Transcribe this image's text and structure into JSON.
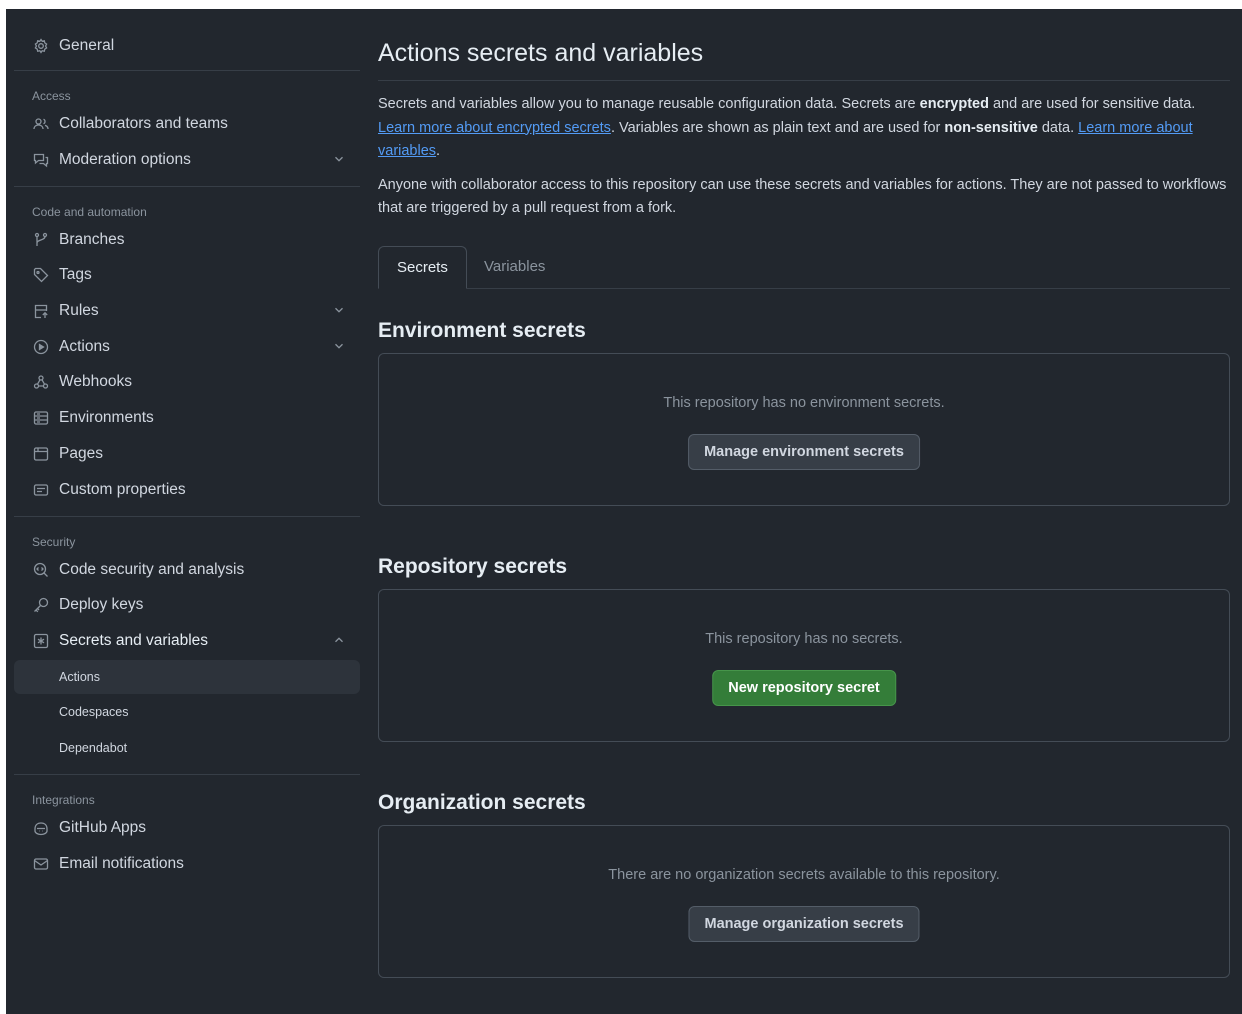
{
  "sidebar": {
    "general": "General",
    "access_label": "Access",
    "collaborators": "Collaborators and teams",
    "moderation": "Moderation options",
    "code_label": "Code and automation",
    "branches": "Branches",
    "tags": "Tags",
    "rules": "Rules",
    "actions": "Actions",
    "webhooks": "Webhooks",
    "environments": "Environments",
    "pages": "Pages",
    "custom_properties": "Custom properties",
    "security_label": "Security",
    "code_security": "Code security and analysis",
    "deploy_keys": "Deploy keys",
    "secrets_variables": "Secrets and variables",
    "sub_actions": "Actions",
    "sub_codespaces": "Codespaces",
    "sub_dependabot": "Dependabot",
    "integrations_label": "Integrations",
    "github_apps": "GitHub Apps",
    "email_notifications": "Email notifications"
  },
  "main": {
    "title": "Actions secrets and variables",
    "desc1_a": "Secrets and variables allow you to manage reusable configuration data. Secrets are ",
    "desc1_b": "encrypted",
    "desc1_c": " and are used for sensitive data. ",
    "desc1_link1": "Learn more about encrypted secrets",
    "desc1_d": ". Variables are shown as plain text and are used for ",
    "desc1_e": "non-sensitive",
    "desc1_f": " data. ",
    "desc1_link2": "Learn more about variables",
    "desc1_g": ".",
    "desc2": "Anyone with collaborator access to this repository can use these secrets and variables for actions. They are not passed to workflows that are triggered by a pull request from a fork.",
    "tabs": {
      "secrets": "Secrets",
      "variables": "Variables"
    },
    "env": {
      "heading": "Environment secrets",
      "message": "This repository has no environment secrets.",
      "button": "Manage environment secrets"
    },
    "repo": {
      "heading": "Repository secrets",
      "message": "This repository has no secrets.",
      "button": "New repository secret"
    },
    "org": {
      "heading": "Organization secrets",
      "message": "There are no organization secrets available to this repository.",
      "button": "Manage organization secrets"
    }
  },
  "colors": {
    "background": "#22272e",
    "accent": "#4184e4",
    "link": "#539bf5",
    "primary_button": "#347d39"
  }
}
